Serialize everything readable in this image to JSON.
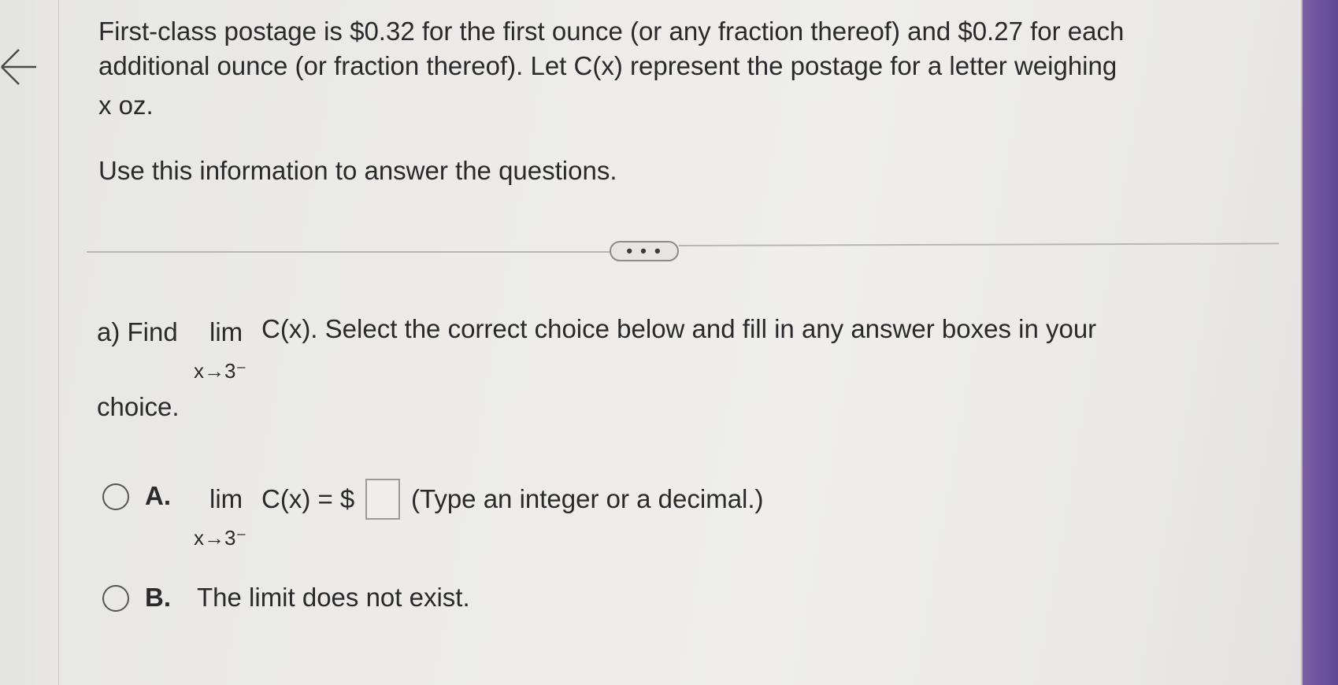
{
  "problem": {
    "line1": "First-class postage is $0.32 for the first ounce (or any fraction thereof) and $0.27 for each",
    "line2": "additional ounce (or fraction thereof). Let C(x) represent the postage for a letter weighing",
    "line3": "x oz.",
    "instruction": "Use this information to answer the questions."
  },
  "expand_button": {
    "label": "• • •"
  },
  "part_a": {
    "prefix": "a) Find",
    "lim": "lim",
    "expression": "C(x). Select the correct choice below and fill in any answer boxes in your",
    "limit_sub": "x→3⁻",
    "continuation": "choice."
  },
  "choices": [
    {
      "letter": "A.",
      "lim": "lim",
      "expression": "C(x) = $",
      "limit_sub": "x→3⁻",
      "answer_value": "",
      "hint": "(Type an integer or a decimal.)"
    },
    {
      "letter": "B.",
      "text": "The limit does not exist."
    }
  ],
  "colors": {
    "background": "#ecebe8",
    "text": "#2a2a2c",
    "purple_edge": "#6f55a1"
  },
  "icons": {
    "back": "left-arrow-icon"
  }
}
